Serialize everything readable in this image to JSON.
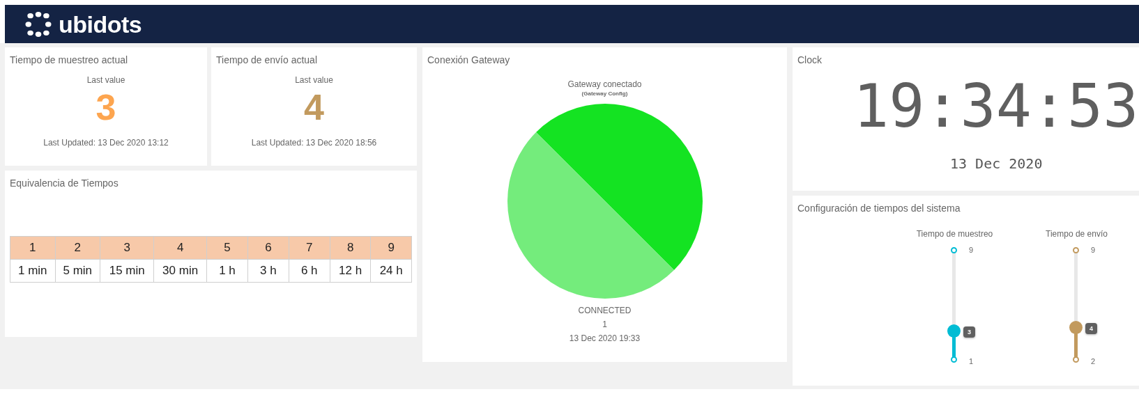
{
  "header": {
    "logo": "ubidots"
  },
  "current_values": [
    {
      "title": "Tiempo de muestreo actual",
      "caption": "Last value",
      "value": "3",
      "color": "#fda54f",
      "updated": "Last Updated: 13 Dec 2020 13:12"
    },
    {
      "title": "Tiempo de envío actual",
      "caption": "Last value",
      "value": "4",
      "color": "#c29a5e",
      "updated": "Last Updated: 13 Dec 2020 18:56"
    }
  ],
  "equivalence": {
    "title": "Equivalencia de Tiempos",
    "table": {
      "columns": [
        "1",
        "2",
        "3",
        "4",
        "5",
        "6",
        "7",
        "8",
        "9"
      ],
      "rows": [
        [
          "1 min",
          "5 min",
          "15 min",
          "30 min",
          "1 h",
          "3 h",
          "6 h",
          "12 h",
          "24 h"
        ]
      ]
    }
  },
  "gateway": {
    "title": "Conexión Gateway",
    "chart_title": "Gateway conectado",
    "chart_subtitle": "(Gateway Config)",
    "status": "CONNECTED",
    "value": "1",
    "timestamp": "13 Dec 2020 19:33"
  },
  "clock": {
    "title": "Clock",
    "time": "19:34:53",
    "date": "13 Dec 2020"
  },
  "config": {
    "title": "Configuración de tiempos del sistema",
    "sliders": [
      {
        "label": "Tiempo de muestreo",
        "max": "9",
        "min": "1",
        "value": "3",
        "level": 0.25,
        "color": "#00bcd4"
      },
      {
        "label": "Tiempo de envío",
        "max": "9",
        "min": "2",
        "value": "4",
        "level": 0.2857,
        "color": "#c29a5e"
      }
    ]
  }
}
